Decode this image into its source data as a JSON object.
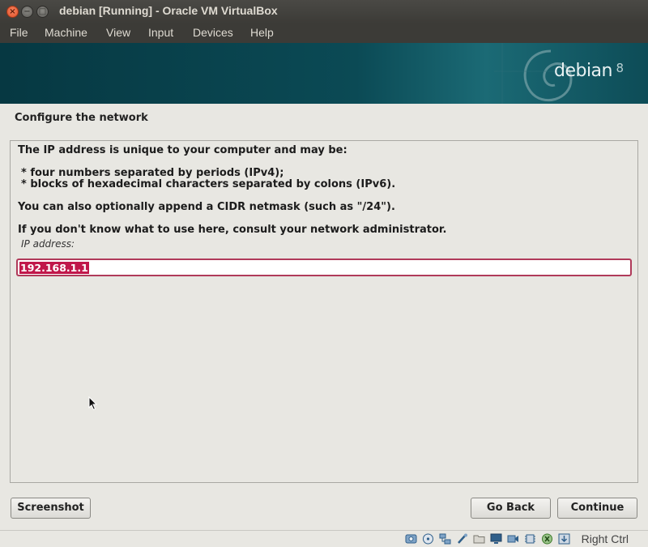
{
  "window": {
    "title": "debian [Running] - Oracle VM VirtualBox",
    "controls": [
      "close-icon",
      "minimize-icon",
      "maximize-icon"
    ]
  },
  "menubar": {
    "items": [
      "File",
      "Machine",
      "View",
      "Input",
      "Devices",
      "Help"
    ]
  },
  "installer": {
    "banner": {
      "logo_text": "debian",
      "version": "8"
    },
    "section_title": "Configure the network",
    "description": {
      "intro": "The IP address is unique to your computer and may be:",
      "bullets": [
        "four numbers separated by periods (IPv4);",
        "blocks of hexadecimal characters separated by colons (IPv6)."
      ],
      "cidr_note": "You can also optionally append a CIDR netmask (such as \"/24\").",
      "admin_note": "If you don't know what to use here, consult your network administrator."
    },
    "ip_field": {
      "label": "IP address:",
      "value": "192.168.1.1"
    },
    "buttons": {
      "screenshot": "Screenshot",
      "go_back": "Go Back",
      "continue": "Continue"
    }
  },
  "statusbar": {
    "icons": [
      "hard-disk-icon",
      "optical-drive-icon",
      "network-icon",
      "usb-icon",
      "shared-folders-icon",
      "display-icon",
      "video-capture-icon",
      "cpu-icon",
      "mouse-integration-icon",
      "keyboard-capture-icon"
    ],
    "host_key": "Right Ctrl"
  },
  "colors": {
    "selection": "#c0174a",
    "field_border": "#b03a5a",
    "banner": "#0b4a55",
    "close_button": "#e0512a"
  }
}
